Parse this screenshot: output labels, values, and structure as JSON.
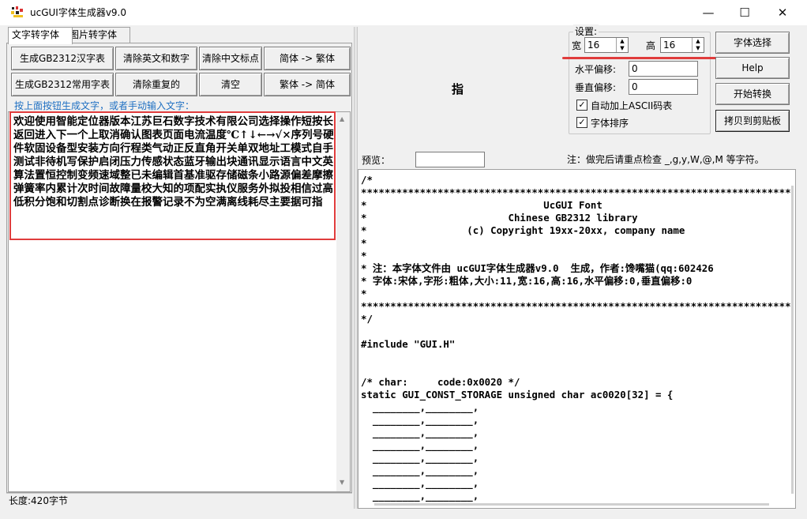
{
  "window": {
    "title": "ucGUI字体生成器v9.0",
    "controls": {
      "minimize": "—",
      "maximize": "☐",
      "close": "✕"
    }
  },
  "tabs": [
    {
      "label": "文字转字体",
      "active": true
    },
    {
      "label": "图片转字体",
      "active": false
    }
  ],
  "left_buttons": {
    "gen_gb2312": "生成GB2312汉字表",
    "clear_en_num": "清除英文和数字",
    "clear_cn_punct": "清除中文标点",
    "simp_to_trad": "简体 -> 繁体",
    "gen_gb2312_common": "生成GB2312常用字表",
    "clear_dup": "清除重复的",
    "clear": "清空",
    "trad_to_simp": "繁体 -> 简体"
  },
  "hint": "按上面按钮生成文字，或者手动输入文字：",
  "input_text": "欢迎使用智能定位器版本江苏巨石数字技术有限公司选择操作短按长返回进入下一个上取消确认图表页面电流温度℃↑↓←→√×序列号硬件软固设备型安装方向行程类气动正反直角开关单双地址工模式自手测试非待机写保护启闭压力传感状态蓝牙输出块通讯显示语言中文英算法置恒控制变频速域整已未编辑首基准驱存储磁条小路源偏差摩擦弹簧率内累计次时间故障量校大知的项配实执仪服务外拟投相信过高低积分饱和切割点诊断换在报警记录不为空满离线耗尽主要据可指",
  "status": "长度:420字节",
  "preview_char": "指",
  "settings": {
    "group_label": "设置:",
    "width_label": "宽",
    "width_value": "16",
    "height_label": "高",
    "height_value": "16",
    "h_offset_label": "水平偏移:",
    "h_offset_value": "0",
    "v_offset_label": "垂直偏移:",
    "v_offset_value": "0",
    "auto_ascii_label": "自动加上ASCII码表",
    "auto_ascii_checked": "✓",
    "sort_label": "字体排序",
    "sort_checked": "✓"
  },
  "right_buttons": {
    "font_select": "字体选择",
    "help": "Help",
    "start": "开始转换",
    "copy": "拷贝到剪贴板"
  },
  "preview_label": "预览：",
  "preview_value": "",
  "note": "注：做完后请重点检查 _,g,y,W,@,M 等字符。",
  "code_text": "/*\n*************************************************************************\n*                              UcGUI Font\n*                        Chinese GB2312 library\n*                 (c) Copyright 19xx-20xx, company name\n*\n*\n* 注：本字体文件由 ucGUI字体生成器v9.0  生成，作者:馋嘴猫(qq:602426\n* 字体:宋体,字形:粗体,大小:11,宽:16,高:16,水平偏移:0,垂直偏移:0\n*\n*************************************************************************\n*/\n\n#include \"GUI.H\"\n\n\n/* char:     code:0x0020 */\nstatic GUI_CONST_STORAGE unsigned char ac0020[32] = {\n  ________,________,\n  ________,________,\n  ________,________,\n  ________,________,\n  ________,________,\n  ________,________,\n  ________,________,\n  ________,________,"
}
